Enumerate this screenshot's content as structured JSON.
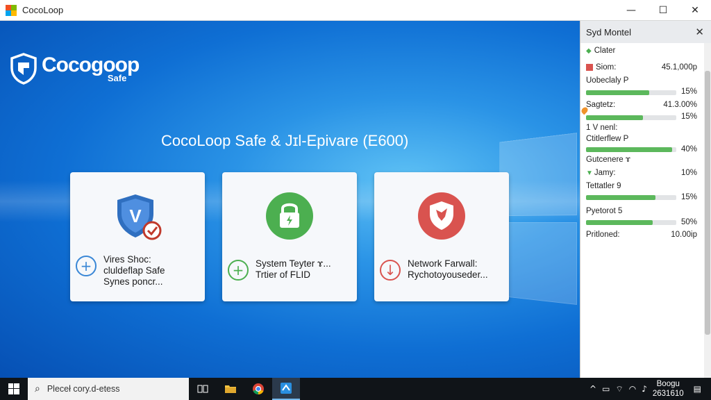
{
  "window": {
    "title": "CocoLoop",
    "minimize_glyph": "—",
    "maximize_glyph": "☐",
    "close_glyph": "✕"
  },
  "brand": {
    "name": "Cocogoop",
    "sub": "Safe"
  },
  "headline": "CocoLoop Safe & Jɪl-Epivare (E600)",
  "cards": [
    {
      "icon": "shield-v-check-icon",
      "action_icon": "plus-circle-icon",
      "action_glyph": "+",
      "accent": "#3a87d6",
      "lines": [
        "Vires Shoc:",
        "cluldeflap Safe",
        "Synes poncr..."
      ]
    },
    {
      "icon": "padlock-icon",
      "action_icon": "plus-circle-icon",
      "action_glyph": "+",
      "accent": "#4caf50",
      "lines": [
        "System Teyter ɤ...",
        "Trtier of FLID"
      ]
    },
    {
      "icon": "firewall-shield-icon",
      "action_icon": "download-circle-icon",
      "action_glyph": "↓",
      "accent": "#d9534f",
      "lines": [
        "Network Farwall:",
        "Rychotoyouseder..."
      ]
    }
  ],
  "panel": {
    "title": "Syd Montel",
    "close_glyph": "✕",
    "status": "Clater",
    "rows": [
      {
        "label": "Siom:",
        "value": "45.1,000p"
      },
      {
        "label": "Uobeclaly P",
        "pct": "15%",
        "fill": 0.7
      },
      {
        "label": "Sagtetz:",
        "value": "41.3.00%"
      },
      {
        "label": "",
        "pct": "15%",
        "fill": 0.63
      },
      {
        "label": "1 V nenl:",
        "value": ""
      },
      {
        "label": "Ctitlerflew P",
        "pct": "40%",
        "fill": 0.95
      },
      {
        "label": "Gutcenere ɤ",
        "value": ""
      },
      {
        "label": "Jamy:",
        "pct": "10%"
      },
      {
        "label": "Tettatler 9",
        "pct": "15%",
        "fill": 0.77
      },
      {
        "label": "Pyetorot 5",
        "pct": "50%",
        "fill": 0.74
      },
      {
        "label": "Pritloned:",
        "value": "10.00ip"
      }
    ]
  },
  "taskbar": {
    "search_placeholder": "Pleceł cory.d-etess",
    "clock_time": "Boogu",
    "clock_date": "2631610"
  },
  "colors": {
    "accent": "#0f6fd4",
    "green": "#5cb85c",
    "red": "#d9534f"
  }
}
